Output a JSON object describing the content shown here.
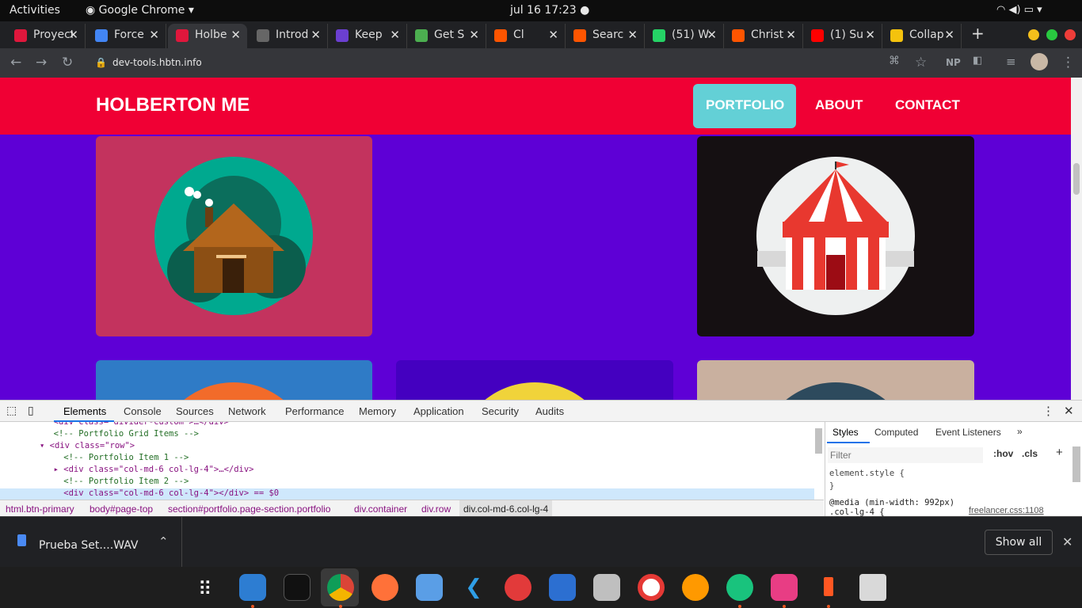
{
  "topbar": {
    "activities": "Activities",
    "app_menu": "Google Chrome",
    "datetime": "jul 16  17:23"
  },
  "tabs": [
    {
      "title": "Proyecto",
      "color": "#e0173c"
    },
    {
      "title": "Force",
      "color": "#4285f4"
    },
    {
      "title": "Holbe",
      "color": "#e0173c",
      "active": true
    },
    {
      "title": "Introd",
      "color": "#666666"
    },
    {
      "title": "Keep",
      "color": "#6b3fd1"
    },
    {
      "title": "Get S",
      "color": "#4caf50"
    },
    {
      "title": "Cl",
      "color": "#ff5500"
    },
    {
      "title": "Searc",
      "color": "#ff5500"
    },
    {
      "title": "(51) W",
      "color": "#25d366"
    },
    {
      "title": "Christ",
      "color": "#ff5500"
    },
    {
      "title": "(1) Su",
      "color": "#ff0000"
    },
    {
      "title": "Collap",
      "color": "#f4c20d"
    }
  ],
  "new_tab_label": "+",
  "address": {
    "url": "dev-tools.hbtn.info",
    "profile_badge": "NP"
  },
  "site": {
    "brand": "HOLBERTON ME",
    "nav": [
      "PORTFOLIO",
      "ABOUT",
      "CONTACT"
    ],
    "colors": {
      "navbar": "#f00034",
      "section": "#5e00d6",
      "active_nav": "#63d0d6"
    },
    "cards": [
      {
        "name": "cabin",
        "bg": "#c3335e"
      },
      {
        "name": "circus-tent",
        "bg": "#151012"
      },
      {
        "name": "cake",
        "bg": "#2f7bc6"
      },
      {
        "name": "safe",
        "bg": "#4400c0"
      },
      {
        "name": "submarine",
        "bg": "#c9b09f"
      }
    ]
  },
  "devtools": {
    "tabs": [
      "Elements",
      "Console",
      "Sources",
      "Network",
      "Performance",
      "Memory",
      "Application",
      "Security",
      "Audits"
    ],
    "code_lines": [
      "  <div class=\"divider-custom\">…</div>",
      "  <!-- Portfolio Grid Items -->",
      "▾ <div class=\"row\">",
      "    <!-- Portfolio Item 1 -->",
      "  ▸ <div class=\"col-md-6 col-lg-4\">…</div>",
      "    <!-- Portfolio Item 2 -->",
      "    <div class=\"col-md-6 col-lg-4\"></div> == $0"
    ],
    "breadcrumbs": [
      "html.btn-primary",
      "body#page-top",
      "section#portfolio.page-section.portfolio",
      "div.container",
      "div.row",
      "div.col-md-6.col-lg-4"
    ],
    "side_tabs": [
      "Styles",
      "Computed",
      "Event Listeners",
      "»"
    ],
    "filter_placeholder": "Filter",
    "hov": ":hov",
    "cls": ".cls",
    "style_lines": [
      "element.style {",
      "}",
      "@media (min-width: 992px)",
      ".col-lg-4 {"
    ],
    "css_source": "freelancer.css:1108"
  },
  "download": {
    "file": "Prueba Set....WAV",
    "show_all": "Show all"
  }
}
